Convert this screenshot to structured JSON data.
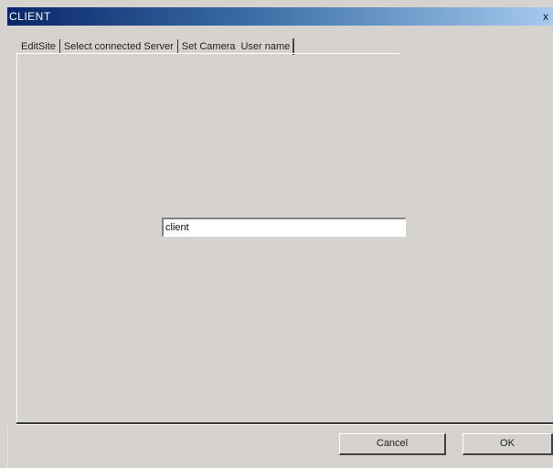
{
  "window": {
    "title": "CLIENT",
    "close_glyph": "x",
    "close_icon": "close-icon"
  },
  "tabs": [
    {
      "label": "EditSite"
    },
    {
      "label": "Select connected Server"
    },
    {
      "label": "Set Camera"
    },
    {
      "label": "User name",
      "active": true
    }
  ],
  "form": {
    "username_value": "client"
  },
  "buttons": {
    "cancel_label": "Cancel",
    "ok_label": "OK"
  },
  "colors": {
    "titlebar_start": "#0a246a",
    "titlebar_end": "#a6caf0",
    "dialog_bg": "#d6d3ce"
  }
}
